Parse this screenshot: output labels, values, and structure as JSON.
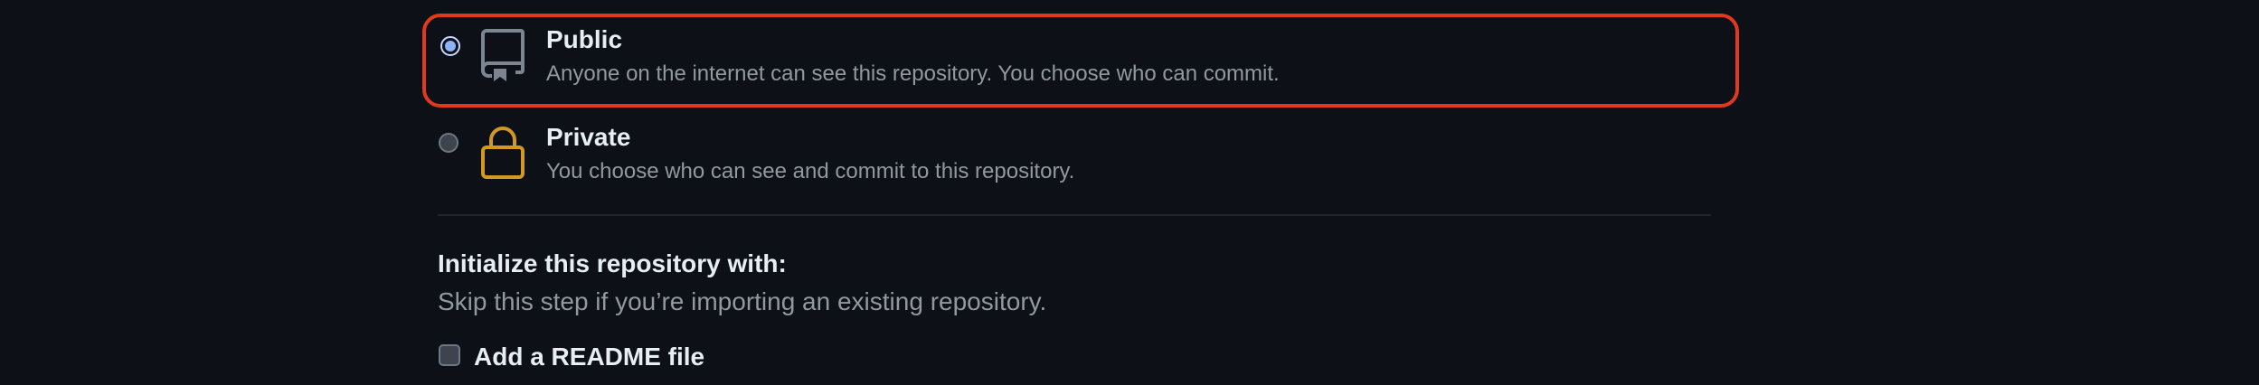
{
  "visibility": {
    "public": {
      "title": "Public",
      "description": "Anyone on the internet can see this repository. You choose who can commit.",
      "selected": true,
      "icon": "repo-book-icon"
    },
    "private": {
      "title": "Private",
      "description": "You choose who can see and commit to this repository.",
      "selected": false,
      "icon": "lock-icon"
    }
  },
  "initialize": {
    "title": "Initialize this repository with:",
    "subtitle": "Skip this step if you’re importing an existing repository.",
    "readme_label": "Add a README file",
    "readme_checked": false
  },
  "colors": {
    "background": "#0d1117",
    "highlight_border": "#e0391f",
    "lock_icon": "#d29922",
    "repo_icon": "#7d8590"
  }
}
